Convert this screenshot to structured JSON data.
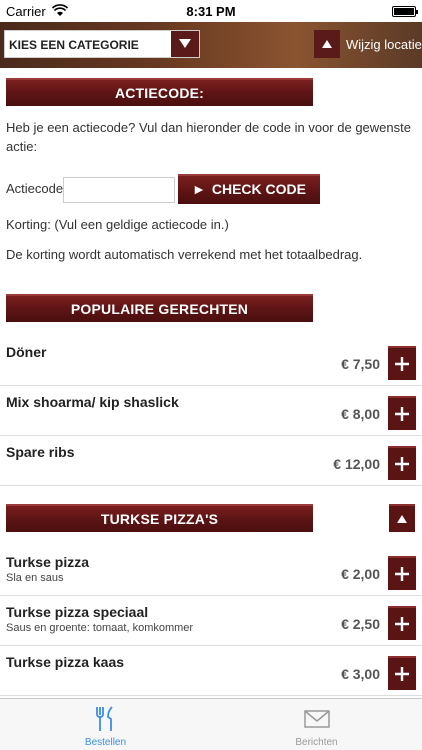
{
  "status_bar": {
    "carrier": "Carrier",
    "time": "8:31 PM"
  },
  "top_bar": {
    "category_select": "KIES EEN CATEGORIE",
    "change_location": "Wijzig locatie"
  },
  "promo": {
    "header": "ACTIECODE:",
    "intro": "Heb je een actiecode? Vul dan hieronder de code in voor de gewenste actie:",
    "field_label": "Actiecode",
    "field_value": "",
    "field_placeholder": "",
    "check_button": "CHECK CODE",
    "discount_text": "Korting: (Vul een geldige actiecode in.)",
    "note": "De korting wordt automatisch verrekend met het totaalbedrag."
  },
  "sections": [
    {
      "title": "POPULAIRE GERECHTEN",
      "items": [
        {
          "name": "Döner",
          "desc": "",
          "price": "€ 7,50"
        },
        {
          "name": "Mix shoarma/ kip shaslick",
          "desc": "",
          "price": "€ 8,00"
        },
        {
          "name": "Spare ribs",
          "desc": "",
          "price": "€ 12,00"
        }
      ]
    },
    {
      "title": "TURKSE PIZZA'S",
      "items": [
        {
          "name": "Turkse pizza",
          "desc": "Sla en saus",
          "price": "€ 2,00"
        },
        {
          "name": "Turkse pizza speciaal",
          "desc": "Saus en groente: tomaat, komkommer",
          "price": "€ 2,50"
        },
        {
          "name": "Turkse pizza kaas",
          "desc": "",
          "price": "€ 3,00"
        }
      ]
    }
  ],
  "tabs": [
    {
      "label": "Bestellen",
      "icon": "cutlery-icon",
      "active": true
    },
    {
      "label": "Berichten",
      "icon": "envelope-icon",
      "active": false
    }
  ],
  "colors": {
    "accent": "#5a1414",
    "tab_active": "#3a8ee6",
    "tab_inactive": "#999999"
  }
}
